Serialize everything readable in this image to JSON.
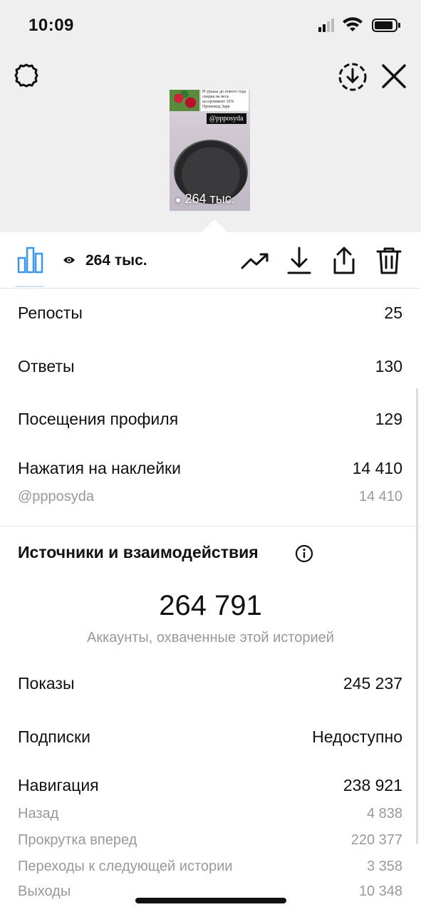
{
  "status_bar": {
    "time": "10:09"
  },
  "top_actions": {
    "settings_icon": "gear-icon",
    "download_icon": "download-circle-icon",
    "close_icon": "close-icon"
  },
  "story_preview": {
    "caption": "И ураааа до нового года скидка на весь ассортимент 10% Промокод Заря",
    "sticker_handle": "@ppposyda",
    "views_overlay": "264 тыс."
  },
  "toolbar": {
    "views_label": "264 тыс.",
    "icons": [
      "bar-chart-icon",
      "eye-icon",
      "promote-trend-icon",
      "download-icon",
      "share-icon",
      "trash-icon"
    ],
    "accent_color": "#3897f0"
  },
  "metrics": [
    {
      "label": "Репосты",
      "value": "25"
    },
    {
      "label": "Ответы",
      "value": "130"
    },
    {
      "label": "Посещения профиля",
      "value": "129"
    },
    {
      "label": "Нажатия на наклейки",
      "value": "14 410"
    }
  ],
  "sticker_detail": {
    "label": "@ppposyda",
    "value": "14 410"
  },
  "discovery": {
    "title": "Источники и взаимодействия",
    "reach_value": "264 791",
    "reach_caption": "Аккаунты, охваченные этой историей",
    "rows": [
      {
        "label": "Показы",
        "value": "245 237"
      },
      {
        "label": "Подписки",
        "value": "Недоступно"
      },
      {
        "label": "Навигация",
        "value": "238 921"
      }
    ],
    "navigation_breakdown": [
      {
        "label": "Назад",
        "value": "4 838"
      },
      {
        "label": "Прокрутка вперед",
        "value": "220 377"
      },
      {
        "label": "Переходы к следующей истории",
        "value": "3 358"
      },
      {
        "label": "Выходы",
        "value": "10 348"
      }
    ]
  }
}
